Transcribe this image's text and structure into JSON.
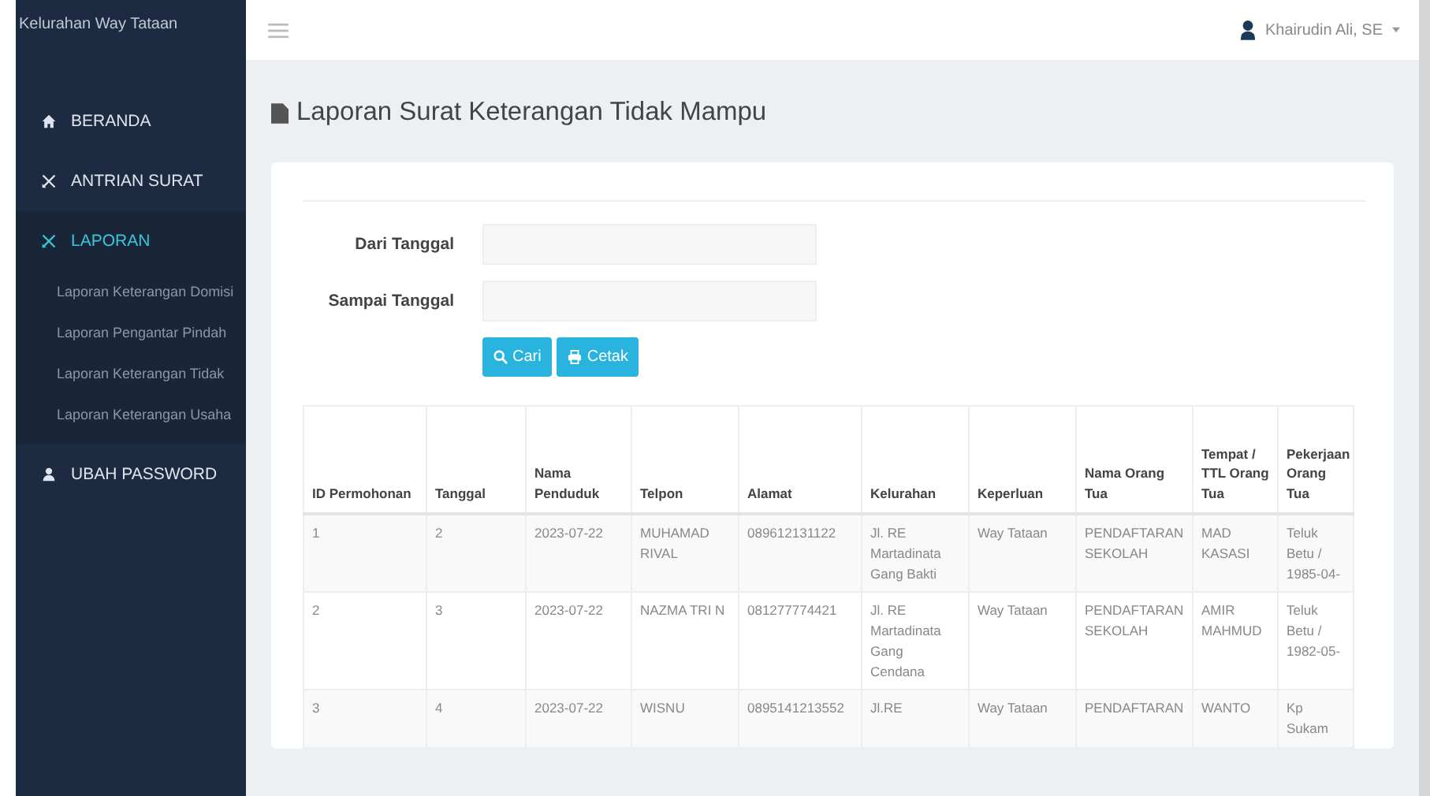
{
  "sidebar": {
    "brand": "Kelurahan Way Tataan",
    "items": [
      {
        "label": "BERANDA",
        "selected": false
      },
      {
        "label": "ANTRIAN SURAT",
        "selected": false
      },
      {
        "label": "LAPORAN",
        "selected": true,
        "children": [
          {
            "label": "Laporan Keterangan Domisi"
          },
          {
            "label": "Laporan Pengantar Pindah"
          },
          {
            "label": "Laporan Keterangan Tidak"
          },
          {
            "label": "Laporan Keterangan Usaha"
          }
        ]
      },
      {
        "label": "UBAH PASSWORD",
        "selected": false
      }
    ]
  },
  "topbar": {
    "user": "Khairudin Ali, SE"
  },
  "page_title": "Laporan Surat Keterangan Tidak Mampu",
  "form": {
    "fields": [
      {
        "label": "Dari Tanggal"
      },
      {
        "label": "Sampai Tanggal"
      }
    ],
    "buttons": [
      {
        "label": "Cari",
        "kind": "search"
      },
      {
        "label": "Cetak",
        "kind": "print"
      }
    ]
  },
  "table": {
    "columns": [
      "ID Permohonan",
      "Tanggal",
      "Nama Penduduk",
      "Telpon",
      "Alamat",
      "Kelurahan",
      "Keperluan",
      "Nama Orang Tua",
      "Tempat / TTL Orang Tua",
      "Pekerjaan Orang Tua"
    ],
    "rows": [
      [
        "1",
        "2",
        "2023-07-22",
        "MUHAMAD RIVAL",
        "089612131122",
        "Jl. RE Martadinata Gang Bakti",
        "Way Tataan",
        "PENDAFTARAN SEKOLAH",
        "MAD KASASI",
        "Teluk Betu / 1985-04-"
      ],
      [
        "2",
        "3",
        "2023-07-22",
        "NAZMA TRI N",
        "081277774421",
        "Jl. RE Martadinata Gang Cendana",
        "Way Tataan",
        "PENDAFTARAN SEKOLAH",
        "AMIR MAHMUD",
        "Teluk Betu / 1982-05-"
      ],
      [
        "3",
        "4",
        "2023-07-22",
        "WISNU",
        "0895141213552",
        "Jl.RE",
        "Way Tataan",
        "PENDAFTARAN",
        "WANTO",
        "Kp Sukam"
      ]
    ]
  }
}
